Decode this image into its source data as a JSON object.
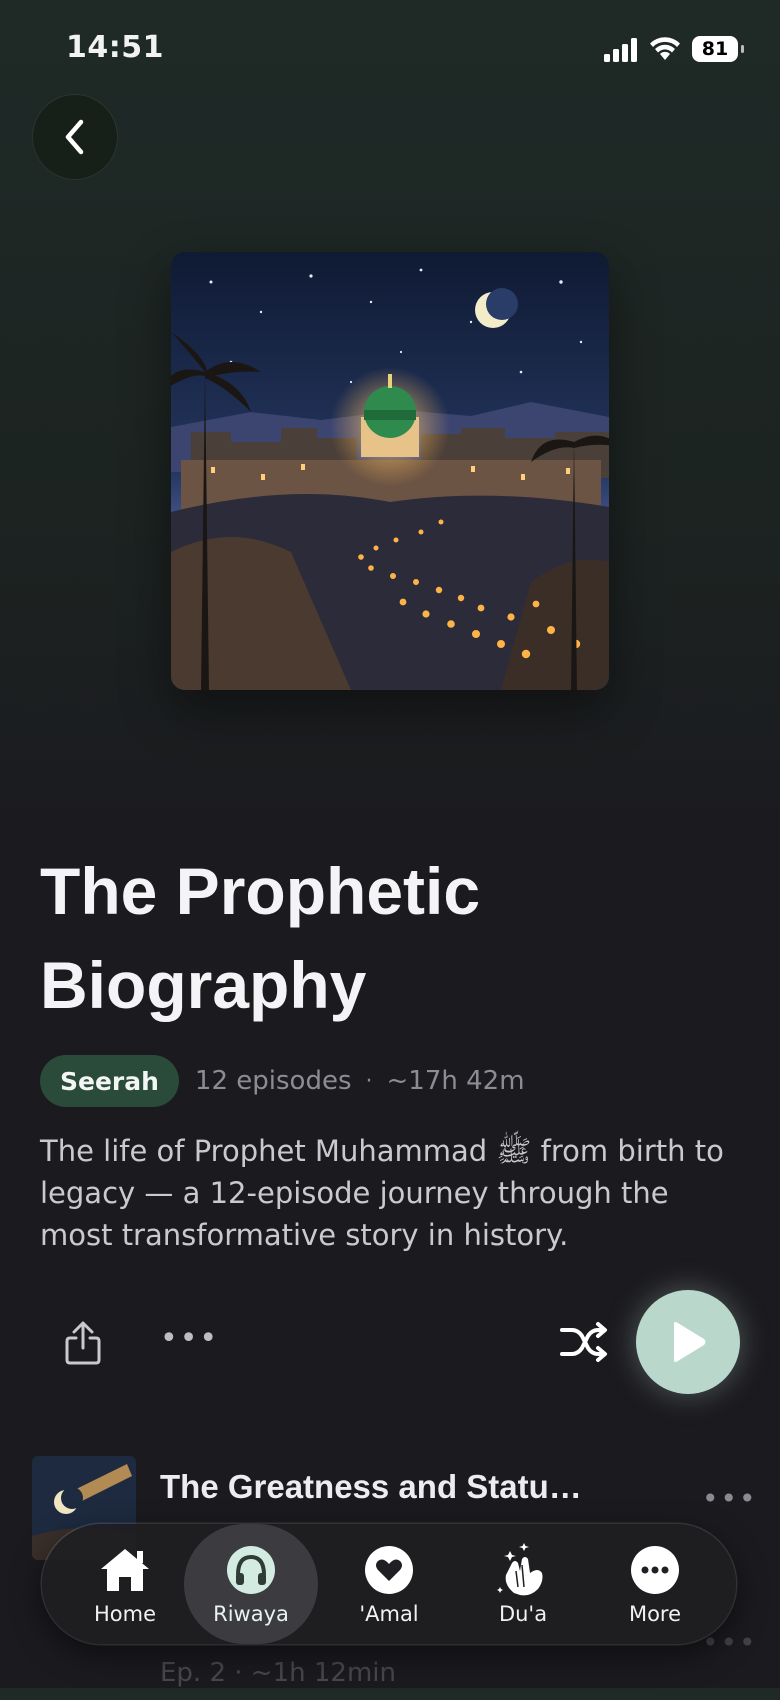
{
  "status_bar": {
    "time": "14:51",
    "battery": "81"
  },
  "navigation": {
    "back_icon": "chevron-left-icon"
  },
  "series": {
    "title": "The Prophetic Biography",
    "category": "Seerah",
    "episode_count": "12 episodes",
    "duration": "~17h 42m",
    "description": "The life of Prophet Muhammad ﷺ from birth to legacy — a 12-episode journey through the most transformative story in history."
  },
  "actions": {
    "share_icon": "share-icon",
    "more_label": "•••",
    "shuffle_icon": "shuffle-icon",
    "play_icon": "play-icon"
  },
  "episodes": [
    {
      "title": "The Greatness and Statu…",
      "more_label": "•••"
    },
    {
      "subtitle": "Ep. 2 · ~1h 12min",
      "more_label": "•••"
    }
  ],
  "tabbar": {
    "items": [
      {
        "label": "Home",
        "icon": "home-icon"
      },
      {
        "label": "Riwaya",
        "icon": "headphones-icon",
        "active": true
      },
      {
        "label": "'Amal",
        "icon": "heart-icon"
      },
      {
        "label": "Du'a",
        "icon": "praying-hands-icon"
      },
      {
        "label": "More",
        "icon": "more-icon"
      }
    ]
  },
  "colors": {
    "accent": "#b9d8cb",
    "tag_bg": "#2a4a3a",
    "background": "#1b1a1f"
  }
}
